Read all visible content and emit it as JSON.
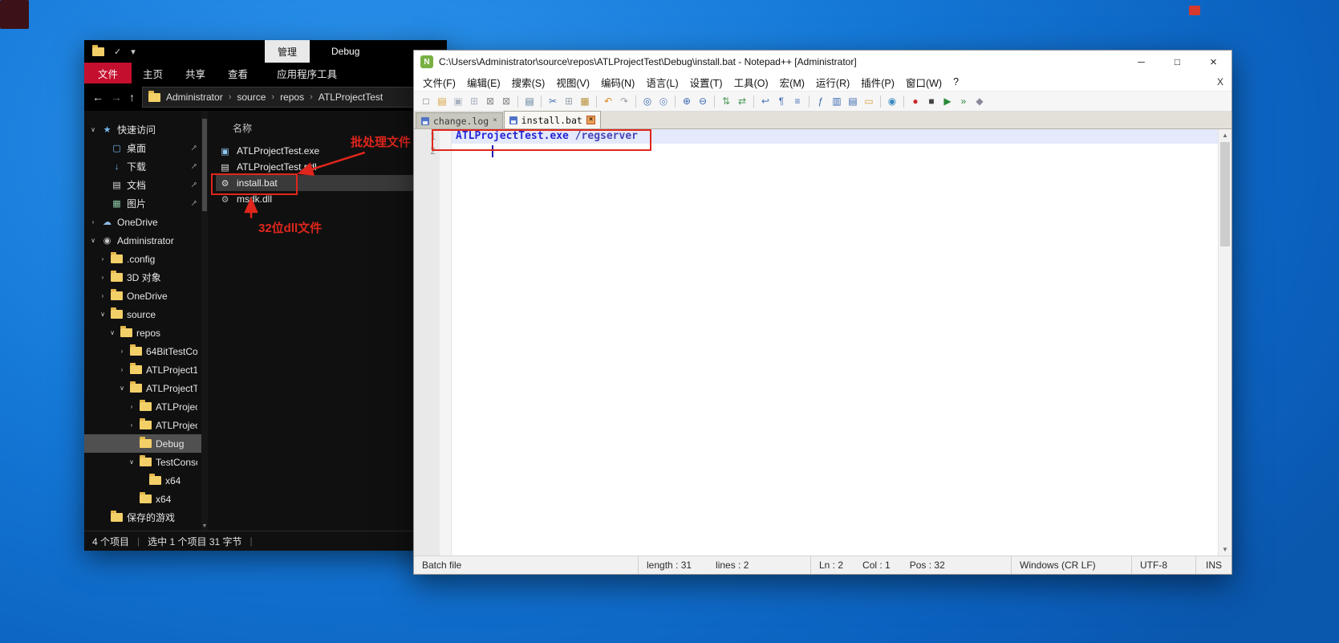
{
  "icons": {
    "star": "★",
    "desktop": "▢",
    "download": "↓",
    "document": "▤",
    "pictures": "▦",
    "cloud": "☁",
    "user": "◉",
    "pin": "⊸",
    "chevron-down": "∨",
    "chevron-right": "›",
    "back": "←",
    "forward": "→",
    "up": "↑",
    "crumb-sep": "›",
    "caret-down": "▾",
    "check": "✓",
    "minimize": "─",
    "maximize": "□",
    "close": "×",
    "scroll-up": "▲",
    "scroll-down": "▼",
    "exe": "▣",
    "pdb": "▤",
    "bat": "⚙",
    "dll": "⚙"
  },
  "explorer": {
    "titlebar": {
      "manage_tab": "管理",
      "title": "Debug"
    },
    "ribbon_tabs": {
      "file": "文件",
      "home": "主页",
      "share": "共享",
      "view": "查看",
      "app_tools": "应用程序工具"
    },
    "breadcrumb": [
      "Administrator",
      "source",
      "repos",
      "ATLProjectTest"
    ],
    "sidebar": [
      {
        "label": "快速访问",
        "icon": "star",
        "depth": 0,
        "chevron": "down",
        "pinned": false,
        "selected": false
      },
      {
        "label": "桌面",
        "icon": "desktop",
        "depth": 1,
        "chevron": "none",
        "pinned": true,
        "selected": false
      },
      {
        "label": "下载",
        "icon": "download",
        "depth": 1,
        "chevron": "none",
        "pinned": true,
        "selected": false
      },
      {
        "label": "文档",
        "icon": "document",
        "depth": 1,
        "chevron": "none",
        "pinned": true,
        "selected": false
      },
      {
        "label": "图片",
        "icon": "pictures",
        "depth": 1,
        "chevron": "none",
        "pinned": true,
        "selected": false
      },
      {
        "label": "OneDrive",
        "icon": "cloud",
        "depth": 0,
        "chevron": "right",
        "pinned": false,
        "selected": false
      },
      {
        "label": "Administrator",
        "icon": "user",
        "depth": 0,
        "chevron": "down",
        "pinned": false,
        "selected": false
      },
      {
        "label": ".config",
        "icon": "folder",
        "depth": 1,
        "chevron": "right",
        "pinned": false,
        "selected": false
      },
      {
        "label": "3D 对象",
        "icon": "folder",
        "depth": 1,
        "chevron": "right",
        "pinned": false,
        "selected": false
      },
      {
        "label": "OneDrive",
        "icon": "folder",
        "depth": 1,
        "chevron": "right",
        "pinned": false,
        "selected": false
      },
      {
        "label": "source",
        "icon": "folder",
        "depth": 1,
        "chevron": "down",
        "pinned": false,
        "selected": false
      },
      {
        "label": "repos",
        "icon": "folder",
        "depth": 2,
        "chevron": "down",
        "pinned": false,
        "selected": false
      },
      {
        "label": "64BitTestCo",
        "icon": "folder",
        "depth": 3,
        "chevron": "right",
        "pinned": false,
        "selected": false
      },
      {
        "label": "ATLProject1",
        "icon": "folder",
        "depth": 3,
        "chevron": "right",
        "pinned": false,
        "selected": false
      },
      {
        "label": "ATLProjectT",
        "icon": "folder",
        "depth": 3,
        "chevron": "down",
        "pinned": false,
        "selected": false
      },
      {
        "label": "ATLProject",
        "icon": "folder",
        "depth": 4,
        "chevron": "right",
        "pinned": false,
        "selected": false
      },
      {
        "label": "ATLProject",
        "icon": "folder",
        "depth": 4,
        "chevron": "right",
        "pinned": false,
        "selected": false
      },
      {
        "label": "Debug",
        "icon": "folder",
        "depth": 4,
        "chevron": "none",
        "pinned": false,
        "selected": true
      },
      {
        "label": "TestConso",
        "icon": "folder",
        "depth": 4,
        "chevron": "down",
        "pinned": false,
        "selected": false
      },
      {
        "label": "x64",
        "icon": "folder",
        "depth": 5,
        "chevron": "none",
        "pinned": false,
        "selected": false
      },
      {
        "label": "x64",
        "icon": "folder",
        "depth": 4,
        "chevron": "none",
        "pinned": false,
        "selected": false
      },
      {
        "label": "保存的游戏",
        "icon": "folder",
        "depth": 1,
        "chevron": "none",
        "pinned": false,
        "selected": false
      }
    ],
    "filelist": {
      "name_header": "名称",
      "files": [
        {
          "name": "ATLProjectTest.exe",
          "icon": "exe",
          "selected": false
        },
        {
          "name": "ATLProjectTest.pdl",
          "icon": "pdb",
          "selected": false
        },
        {
          "name": "install.bat",
          "icon": "bat",
          "selected": true
        },
        {
          "name": "msdk.dll",
          "icon": "dll",
          "selected": false
        }
      ]
    },
    "annotations": {
      "batch_label": "批处理文件",
      "dll_label": "32位dll文件",
      "accent_color": "#e0261c"
    },
    "statusbar": {
      "items": "4 个项目",
      "selection": "选中 1 个项目 31 字节"
    }
  },
  "notepad": {
    "titlebar": {
      "title": "C:\\Users\\Administrator\\source\\repos\\ATLProjectTest\\Debug\\install.bat - Notepad++ [Administrator]"
    },
    "menu": [
      {
        "label": "文件(F)",
        "name": "menu-file"
      },
      {
        "label": "编辑(E)",
        "name": "menu-edit"
      },
      {
        "label": "搜索(S)",
        "name": "menu-search"
      },
      {
        "label": "视图(V)",
        "name": "menu-view"
      },
      {
        "label": "编码(N)",
        "name": "menu-encoding"
      },
      {
        "label": "语言(L)",
        "name": "menu-language"
      },
      {
        "label": "设置(T)",
        "name": "menu-settings"
      },
      {
        "label": "工具(O)",
        "name": "menu-tools"
      },
      {
        "label": "宏(M)",
        "name": "menu-macro"
      },
      {
        "label": "运行(R)",
        "name": "menu-run"
      },
      {
        "label": "插件(P)",
        "name": "menu-plugins"
      },
      {
        "label": "窗口(W)",
        "name": "menu-window"
      },
      {
        "label": "?",
        "name": "menu-help"
      }
    ],
    "menu_close": "X",
    "toolbar": [
      {
        "name": "new-file-icon",
        "glyph": "□",
        "color": "#6e6e6e"
      },
      {
        "name": "open-file-icon",
        "glyph": "▤",
        "color": "#d9a33c"
      },
      {
        "name": "save-file-icon",
        "glyph": "▣",
        "color": "#aab4c0"
      },
      {
        "name": "save-all-icon",
        "glyph": "⊞",
        "color": "#aab4c0"
      },
      {
        "name": "close-file-icon",
        "glyph": "⊠",
        "color": "#8a8a8a"
      },
      {
        "name": "close-all-icon",
        "glyph": "⊠",
        "color": "#8a8a8a"
      },
      {
        "sep": true
      },
      {
        "name": "print-icon",
        "glyph": "▤",
        "color": "#5a7d9a"
      },
      {
        "sep": true
      },
      {
        "name": "cut-icon",
        "glyph": "✂",
        "color": "#4a72b8"
      },
      {
        "name": "copy-icon",
        "glyph": "⊞",
        "color": "#9aa4b0"
      },
      {
        "name": "paste-icon",
        "glyph": "▦",
        "color": "#b8923a"
      },
      {
        "sep": true
      },
      {
        "name": "undo-icon",
        "glyph": "↶",
        "color": "#e08a1e"
      },
      {
        "name": "redo-icon",
        "glyph": "↷",
        "color": "#9aa0a8"
      },
      {
        "sep": true
      },
      {
        "name": "find-icon",
        "glyph": "◎",
        "color": "#3a6ab0"
      },
      {
        "name": "replace-icon",
        "glyph": "◎",
        "color": "#6a8ac0"
      },
      {
        "sep": true
      },
      {
        "name": "zoom-in-icon",
        "glyph": "⊕",
        "color": "#3a6ab0"
      },
      {
        "name": "zoom-out-icon",
        "glyph": "⊖",
        "color": "#3a6ab0"
      },
      {
        "sep": true
      },
      {
        "name": "sync-vertical-icon",
        "glyph": "⇅",
        "color": "#4a9a5a"
      },
      {
        "name": "sync-horizontal-icon",
        "glyph": "⇄",
        "color": "#4a9a5a"
      },
      {
        "sep": true
      },
      {
        "name": "word-wrap-icon",
        "glyph": "↩",
        "color": "#4a72b8"
      },
      {
        "name": "show-all-characters-icon",
        "glyph": "¶",
        "color": "#4a72b8"
      },
      {
        "name": "indent-guide-icon",
        "glyph": "≡",
        "color": "#4a72b8"
      },
      {
        "sep": true
      },
      {
        "name": "function-list-icon",
        "glyph": "ƒ",
        "color": "#3a6ab0"
      },
      {
        "name": "document-map-icon",
        "glyph": "▥",
        "color": "#3a6ab0"
      },
      {
        "name": "document-list-icon",
        "glyph": "▤",
        "color": "#3a6ab0"
      },
      {
        "name": "folder-as-workspace-icon",
        "glyph": "▭",
        "color": "#d9a33c"
      },
      {
        "sep": true
      },
      {
        "name": "monitoring-icon",
        "glyph": "◉",
        "color": "#3a8ac0"
      },
      {
        "sep": true
      },
      {
        "name": "macro-record-icon",
        "glyph": "●",
        "color": "#cc2a2a"
      },
      {
        "name": "macro-stop-icon",
        "glyph": "■",
        "color": "#444444"
      },
      {
        "name": "macro-play-icon",
        "glyph": "▶",
        "color": "#2a8a3a"
      },
      {
        "name": "macro-run-icon",
        "glyph": "»",
        "color": "#2a8a3a"
      },
      {
        "name": "macro-save-icon",
        "glyph": "◆",
        "color": "#8a8a9a"
      }
    ],
    "tabs": [
      {
        "label": "change.log",
        "active": false
      },
      {
        "label": "install.bat",
        "active": true
      }
    ],
    "editor": {
      "lines": [
        {
          "num": "1",
          "highlight": true,
          "tokens": [
            {
              "text": "ATLProjectTest.exe",
              "cls": "cmd"
            },
            {
              "text": " ",
              "cls": "plain"
            },
            {
              "text": "/regserver",
              "cls": "arg"
            }
          ]
        },
        {
          "num": "2",
          "highlight": false,
          "tokens": []
        }
      ]
    },
    "statusbar": {
      "doc_type": "Batch file",
      "length": "length : 31",
      "lines": "lines : 2",
      "ln": "Ln : 2",
      "col": "Col : 1",
      "pos": "Pos : 32",
      "eol": "Windows (CR LF)",
      "encoding": "UTF-8",
      "insert_mode": "INS"
    }
  }
}
